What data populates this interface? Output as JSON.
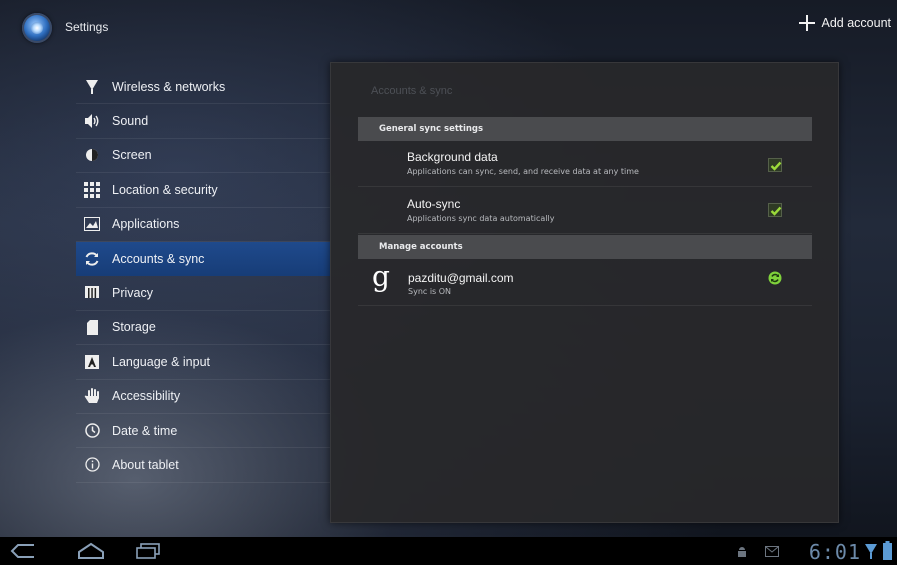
{
  "actionbar": {
    "app_title": "Settings",
    "add_account_label": "Add account"
  },
  "menu": {
    "items": [
      {
        "label": "Wireless & networks",
        "icon": "wifi-icon"
      },
      {
        "label": "Sound",
        "icon": "speaker-icon"
      },
      {
        "label": "Screen",
        "icon": "brightness-icon"
      },
      {
        "label": "Location & security",
        "icon": "grid-icon"
      },
      {
        "label": "Applications",
        "icon": "apps-icon"
      },
      {
        "label": "Accounts & sync",
        "icon": "sync-icon",
        "selected": true
      },
      {
        "label": "Privacy",
        "icon": "privacy-icon"
      },
      {
        "label": "Storage",
        "icon": "sd-card-icon"
      },
      {
        "label": "Language & input",
        "icon": "keyboard-icon"
      },
      {
        "label": "Accessibility",
        "icon": "hand-icon"
      },
      {
        "label": "Date & time",
        "icon": "clock-icon"
      },
      {
        "label": "About tablet",
        "icon": "info-icon"
      }
    ]
  },
  "panel": {
    "title": "Accounts & sync",
    "general_header": "General sync settings",
    "background_data": {
      "title": "Background data",
      "subtitle": "Applications can sync, send, and receive data at any time",
      "checked": true
    },
    "auto_sync": {
      "title": "Auto-sync",
      "subtitle": "Applications sync data automatically",
      "checked": true
    },
    "manage_header": "Manage accounts",
    "account": {
      "icon_glyph": "g",
      "email": "pazditu@gmail.com",
      "status": "Sync is ON"
    }
  },
  "sysbar": {
    "time": "6:01"
  },
  "colors": {
    "selected": "#1f4a8c",
    "check_green": "#9ad93a",
    "clock": "#6c8aa9"
  }
}
